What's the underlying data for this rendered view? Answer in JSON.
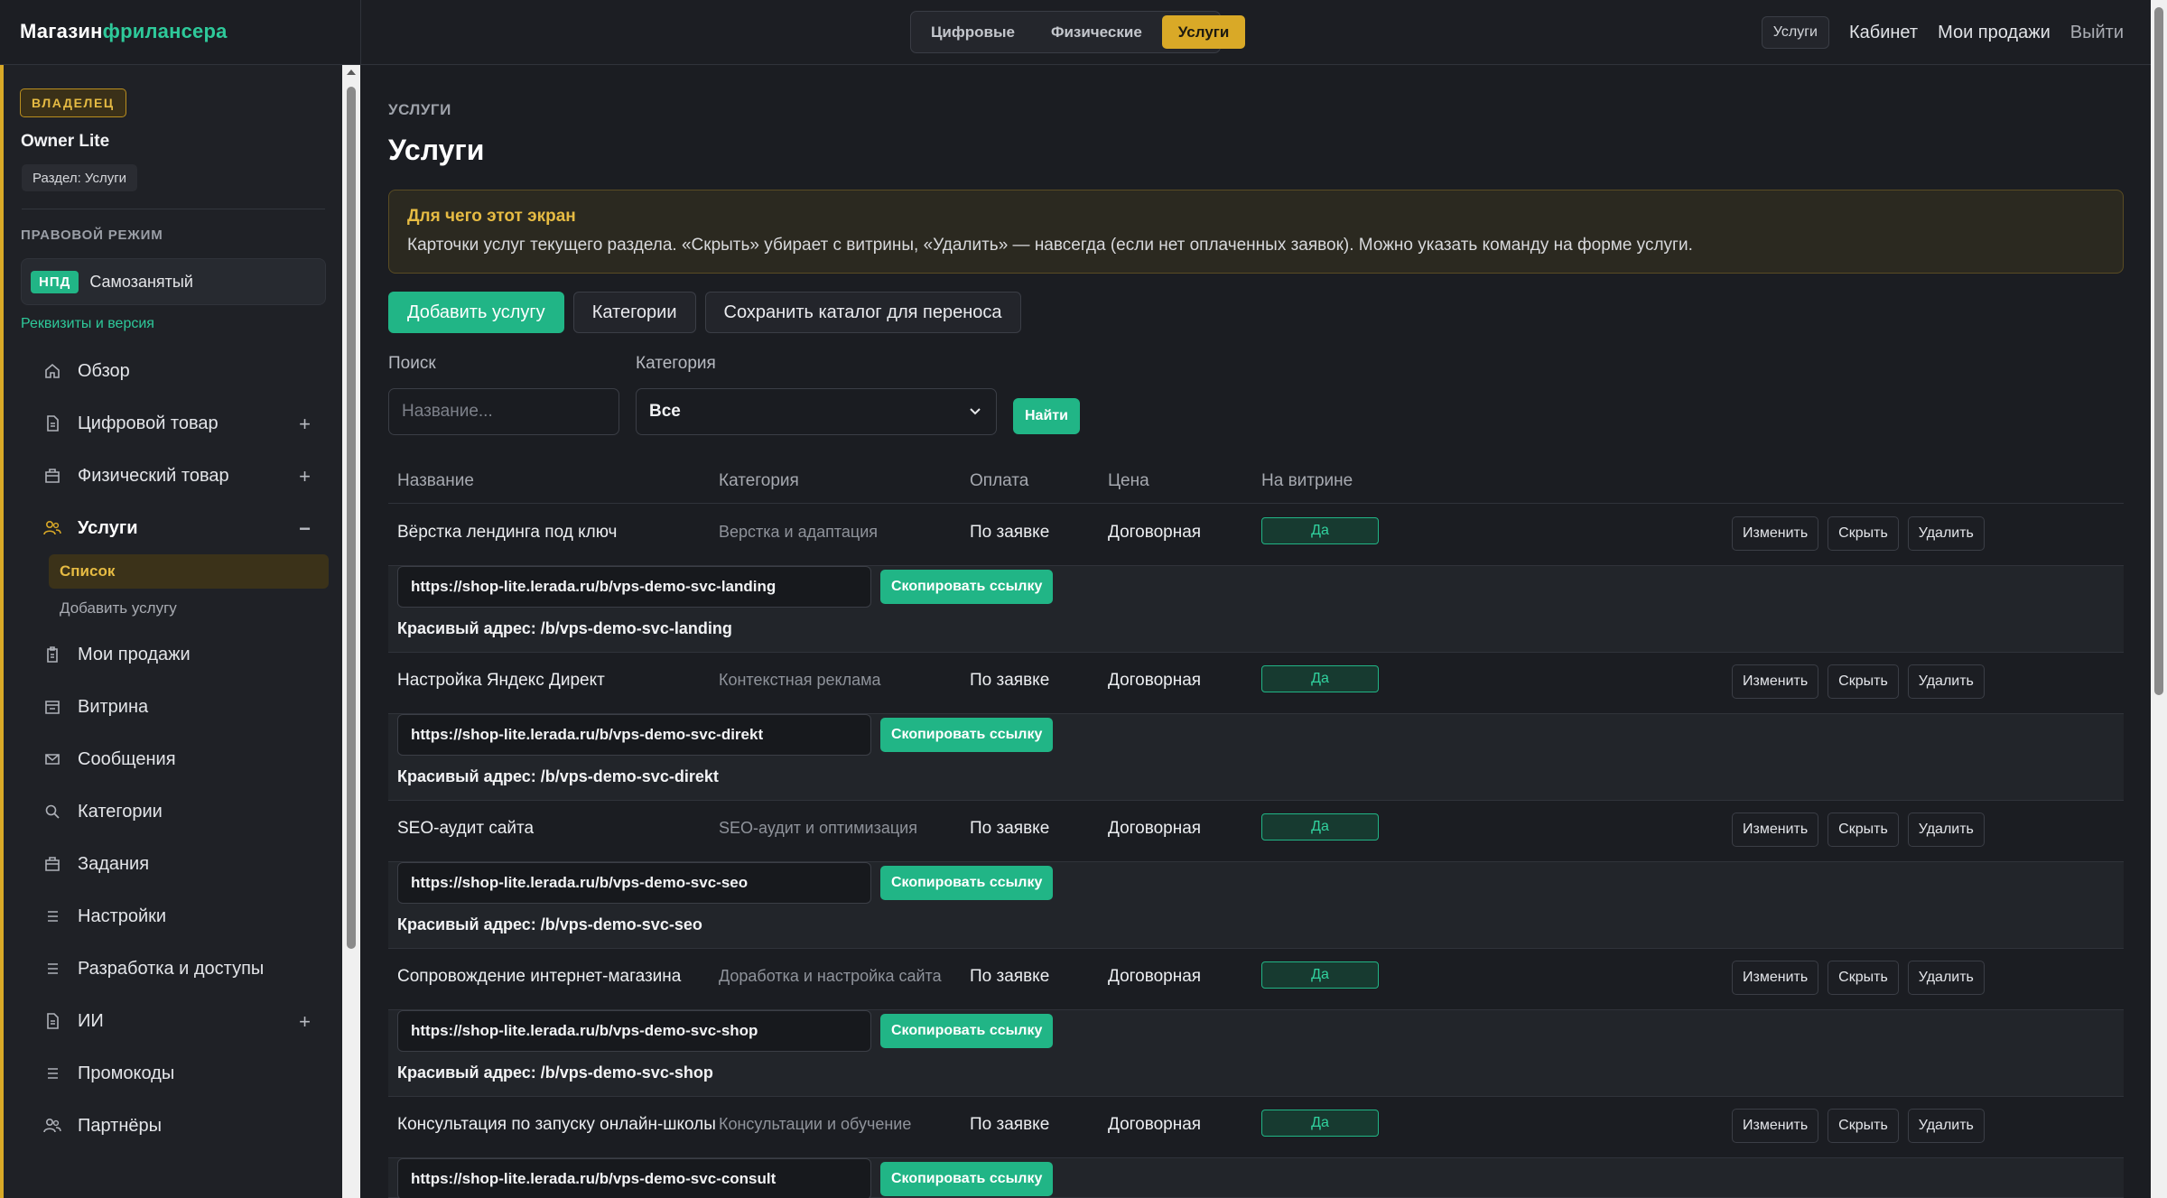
{
  "brand": {
    "part1": "Магазин",
    "part2": "фрилансера"
  },
  "segments": [
    {
      "label": "Цифровые",
      "active": false
    },
    {
      "label": "Физические",
      "active": false
    },
    {
      "label": "Услуги",
      "active": true
    }
  ],
  "topnav": {
    "pill": "Услуги",
    "cabinet": "Кабинет",
    "sales": "Мои продажи",
    "logout": "Выйти"
  },
  "sidebar": {
    "owner_badge": "ВЛАДЕЛЕЦ",
    "owner_name": "Owner Lite",
    "section_chip": "Раздел: Услуги",
    "legal_title": "ПРАВОВОЙ РЕЖИМ",
    "legal_badge": "НПД",
    "legal_text": "Самозанятый",
    "requisites": "Реквизиты и версия",
    "menu": [
      {
        "label": "Обзор",
        "icon": "home-icon"
      },
      {
        "label": "Цифровой товар",
        "icon": "file-icon",
        "toggle": "+"
      },
      {
        "label": "Физический товар",
        "icon": "box-icon",
        "toggle": "+"
      },
      {
        "label": "Услуги",
        "icon": "users-icon",
        "toggle": "−"
      },
      {
        "label": "Мои продажи",
        "icon": "clipboard-icon"
      },
      {
        "label": "Витрина",
        "icon": "store-icon"
      },
      {
        "label": "Сообщения",
        "icon": "mail-icon"
      },
      {
        "label": "Категории",
        "icon": "search-icon"
      },
      {
        "label": "Задания",
        "icon": "box-icon"
      },
      {
        "label": "Настройки",
        "icon": "lines-icon"
      },
      {
        "label": "Разработка и доступы",
        "icon": "lines-icon"
      },
      {
        "label": "ИИ",
        "icon": "file-icon",
        "toggle": "+"
      },
      {
        "label": "Промокоды",
        "icon": "lines-icon"
      },
      {
        "label": "Партнёры",
        "icon": "users-icon"
      }
    ],
    "submenu": {
      "active": "Список",
      "add": "Добавить услугу"
    }
  },
  "main": {
    "crumb": "УСЛУГИ",
    "title": "Услуги",
    "info_title": "Для чего этот экран",
    "info_text": "Карточки услуг текущего раздела. «Скрыть» убирает с витрины, «Удалить» — навсегда (если нет оплаченных заявок). Можно указать команду на форме услуги.",
    "buttons": {
      "add": "Добавить услугу",
      "categories": "Категории",
      "save": "Сохранить каталог для переноса"
    },
    "search_label": "Поиск",
    "search_placeholder": "Название...",
    "category_label": "Категория",
    "category_value": "Все",
    "find": "Найти",
    "columns": {
      "name": "Название",
      "category": "Категория",
      "payment": "Оплата",
      "price": "Цена",
      "showcase": "На витрине"
    },
    "row_actions": {
      "edit": "Изменить",
      "hide": "Скрыть",
      "delete": "Удалить"
    },
    "copy_label": "Скопировать ссылку",
    "pretty_prefix": "Красивый адрес:"
  },
  "services": [
    {
      "name": "Вёрстка лендинга под ключ",
      "category": "Верстка и адаптация",
      "payment": "По заявке",
      "price": "Договорная",
      "showcase": "Да",
      "url": "https://shop-lite.lerada.ru/b/vps-demo-svc-landing",
      "pretty": "Красивый адрес: /b/vps-demo-svc-landing"
    },
    {
      "name": "Настройка Яндекс Директ",
      "category": "Контекстная реклама",
      "payment": "По заявке",
      "price": "Договорная",
      "showcase": "Да",
      "url": "https://shop-lite.lerada.ru/b/vps-demo-svc-direkt",
      "pretty": "Красивый адрес: /b/vps-demo-svc-direkt"
    },
    {
      "name": "SEO-аудит сайта",
      "category": "SEO-аудит и оптимизация",
      "payment": "По заявке",
      "price": "Договорная",
      "showcase": "Да",
      "url": "https://shop-lite.lerada.ru/b/vps-demo-svc-seo",
      "pretty": "Красивый адрес: /b/vps-demo-svc-seo"
    },
    {
      "name": "Сопровождение интернет-магазина",
      "category": "Доработка и настройка сайта",
      "payment": "По заявке",
      "price": "Договорная",
      "showcase": "Да",
      "url": "https://shop-lite.lerada.ru/b/vps-demo-svc-shop",
      "pretty": "Красивый адрес: /b/vps-demo-svc-shop"
    },
    {
      "name": "Консультация по запуску онлайн-школы",
      "category": "Консультации и обучение",
      "payment": "По заявке",
      "price": "Договорная",
      "showcase": "Да",
      "url": "https://shop-lite.lerada.ru/b/vps-demo-svc-consult",
      "pretty": ""
    }
  ]
}
